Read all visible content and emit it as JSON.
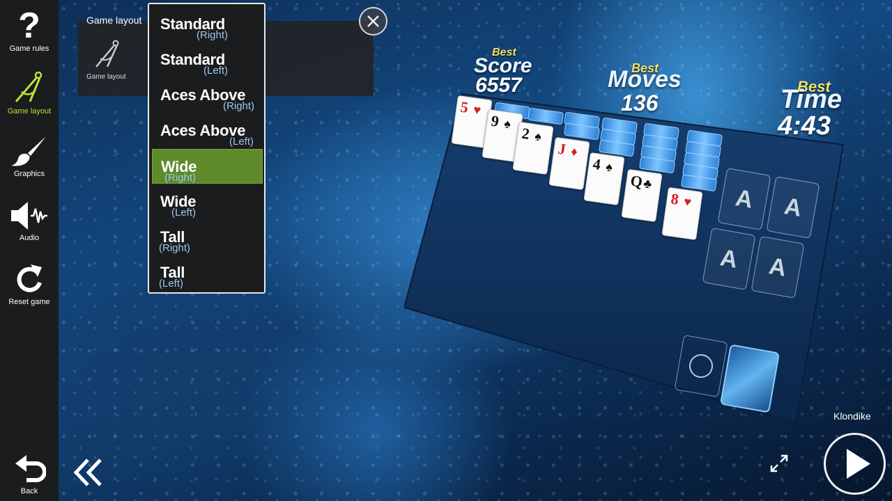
{
  "sidebar": {
    "items": [
      {
        "label": "Game rules",
        "icon": "question-icon"
      },
      {
        "label": "Game layout",
        "icon": "compass-icon"
      },
      {
        "label": "Graphics",
        "icon": "paintbrush-icon"
      },
      {
        "label": "Audio",
        "icon": "speaker-icon"
      },
      {
        "label": "Reset game",
        "icon": "reset-icon"
      }
    ],
    "back_label": "Back",
    "active_color": "#b8e23a"
  },
  "panel": {
    "title": "Game layout",
    "icon_label": "Game layout"
  },
  "dropdown": {
    "options": [
      {
        "main": "Standard",
        "sub": "(Right)"
      },
      {
        "main": "Standard",
        "sub": "(Left)"
      },
      {
        "main": "Aces Above",
        "sub": "(Right)"
      },
      {
        "main": "Aces Above",
        "sub": "(Left)"
      },
      {
        "main": "Wide",
        "sub": "(Right)"
      },
      {
        "main": "Wide",
        "sub": "(Left)"
      },
      {
        "main": "Tall",
        "sub": "(Right)"
      },
      {
        "main": "Tall",
        "sub": "(Left)"
      }
    ],
    "selected_index": 4,
    "selected_color": "#5e8a2c"
  },
  "stats": {
    "score": {
      "best": "Best",
      "label": "Score",
      "value": "6557"
    },
    "moves": {
      "best": "Best",
      "label": "Moves",
      "value": "136"
    },
    "time": {
      "best": "Best",
      "label": "Time",
      "value": "4:43"
    }
  },
  "tableau": [
    {
      "rank": "5",
      "suit": "♥",
      "color": "red"
    },
    {
      "rank": "9",
      "suit": "♠",
      "color": "blk"
    },
    {
      "rank": "2",
      "suit": "♠",
      "color": "blk"
    },
    {
      "rank": "J",
      "suit": "♦",
      "color": "red"
    },
    {
      "rank": "4",
      "suit": "♠",
      "color": "blk"
    },
    {
      "rank": "Q",
      "suit": "♣",
      "color": "blk"
    },
    {
      "rank": "8",
      "suit": "♥",
      "color": "red"
    }
  ],
  "foundations": [
    "A",
    "A",
    "A",
    "A"
  ],
  "game_mode": "Klondike"
}
